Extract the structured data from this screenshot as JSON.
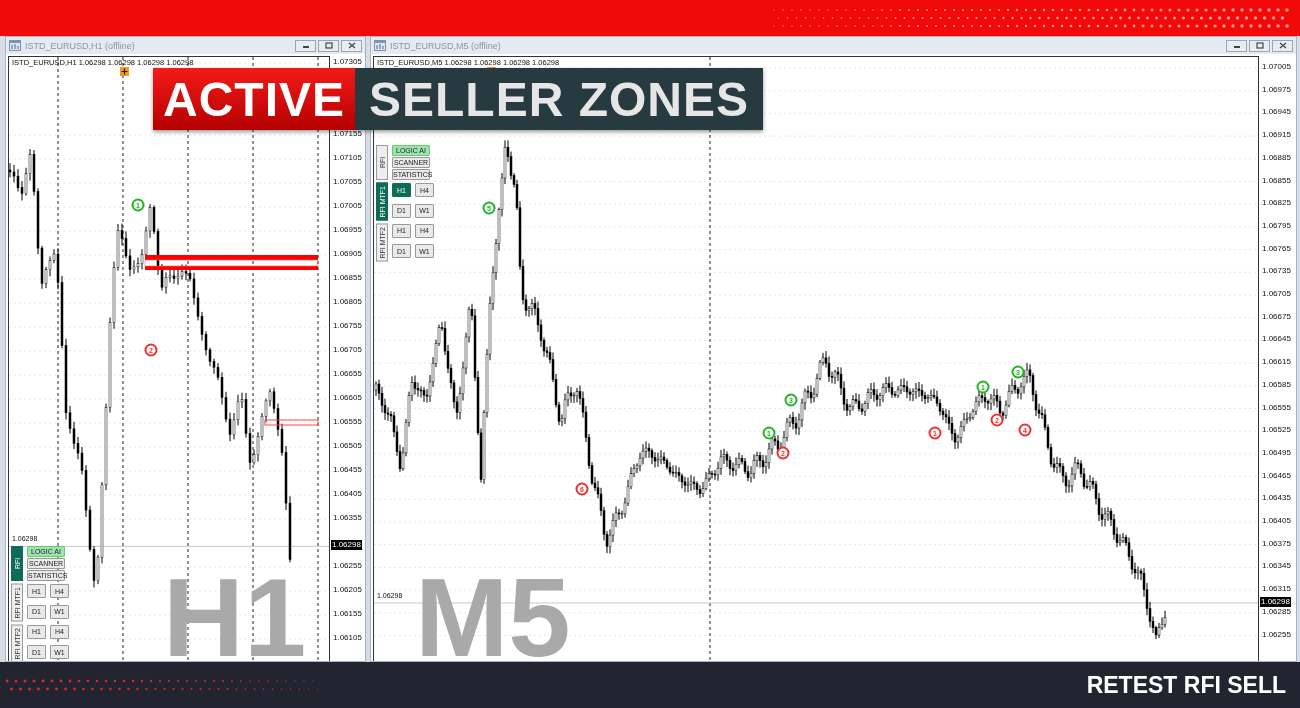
{
  "headline": {
    "highlight": "ACTIVE",
    "text": "SELLER ZONES"
  },
  "windows": [
    {
      "title": "ISTD_EURUSD,H1 (offline)",
      "quote": "ISTD_EURUSD,H1  1.06298 1.06298 1.06298 1.06298",
      "bid_label": "1.06298",
      "price_tag": "1.06298",
      "timeframe_overlay": "H1",
      "axis_labels": [
        "1.07305",
        "1.07155",
        "1.07105",
        "1.07055",
        "1.07005",
        "1.06955",
        "1.06905",
        "1.06855",
        "1.06805",
        "1.06755",
        "1.06705",
        "1.06655",
        "1.06605",
        "1.06555",
        "1.06505",
        "1.06455",
        "1.06405",
        "1.06355",
        "1.06255",
        "1.06205",
        "1.06155",
        "1.06105"
      ],
      "signals": [
        {
          "label": "1",
          "color": "#22b422"
        },
        {
          "label": "2",
          "color": "#ee3030"
        }
      ],
      "panel": [
        {
          "tab": "RFI",
          "selected": true,
          "kind": "list",
          "buttons": [
            {
              "label": "LOGIC AI",
              "selected": true
            },
            {
              "label": "SCANNER",
              "selected": false
            },
            {
              "label": "STATISTICS",
              "selected": false
            }
          ]
        },
        {
          "tab": "RFI MTF1",
          "selected": false,
          "kind": "grid",
          "buttons": [
            {
              "label": "H1",
              "selected": false
            },
            {
              "label": "H4",
              "selected": false
            },
            {
              "label": "D1",
              "selected": false
            },
            {
              "label": "W1",
              "selected": false
            }
          ]
        },
        {
          "tab": "RFI MTF2",
          "selected": false,
          "kind": "grid",
          "buttons": [
            {
              "label": "H1",
              "selected": false
            },
            {
              "label": "H4",
              "selected": false
            },
            {
              "label": "D1",
              "selected": false
            },
            {
              "label": "W1",
              "selected": false
            }
          ]
        }
      ]
    },
    {
      "title": "ISTD_EURUSD,M5 (offline)",
      "quote": "ISTD_EURUSD,M5  1.06298 1.06298 1.06298 1.06298",
      "bid_label": "1.06298",
      "price_tag": "1.06298",
      "timeframe_overlay": "M5",
      "axis_labels": [
        "1.07005",
        "1.06975",
        "1.06945",
        "1.06915",
        "1.06885",
        "1.06855",
        "1.06825",
        "1.06795",
        "1.06765",
        "1.06735",
        "1.06705",
        "1.06675",
        "1.06645",
        "1.06615",
        "1.06585",
        "1.06555",
        "1.06525",
        "1.06495",
        "1.06465",
        "1.06435",
        "1.06405",
        "1.06375",
        "1.06345",
        "1.06315",
        "1.06285",
        "1.06255"
      ],
      "signals": [
        {
          "label": "5",
          "color": "#22b422"
        },
        {
          "label": "6",
          "color": "#ee3030"
        },
        {
          "label": "1",
          "color": "#22b422"
        },
        {
          "label": "3",
          "color": "#22b422"
        },
        {
          "label": "2",
          "color": "#ee3030"
        },
        {
          "label": "1",
          "color": "#ee3030"
        },
        {
          "label": "1",
          "color": "#22b422"
        },
        {
          "label": "2",
          "color": "#ee3030"
        },
        {
          "label": "3",
          "color": "#22b422"
        },
        {
          "label": "4",
          "color": "#ee3030"
        }
      ],
      "panel": [
        {
          "tab": "RFI",
          "selected": false,
          "kind": "list",
          "buttons": [
            {
              "label": "LOGIC AI",
              "selected": true
            },
            {
              "label": "SCANNER",
              "selected": false
            },
            {
              "label": "STATISTICS",
              "selected": false
            }
          ]
        },
        {
          "tab": "RFI MTF1",
          "selected": true,
          "kind": "grid",
          "buttons": [
            {
              "label": "H1",
              "selected": true
            },
            {
              "label": "H4",
              "selected": false
            },
            {
              "label": "D1",
              "selected": false
            },
            {
              "label": "W1",
              "selected": false
            }
          ]
        },
        {
          "tab": "RFI MTF2",
          "selected": false,
          "kind": "grid",
          "buttons": [
            {
              "label": "H1",
              "selected": false
            },
            {
              "label": "H4",
              "selected": false
            },
            {
              "label": "D1",
              "selected": false
            },
            {
              "label": "W1",
              "selected": false
            }
          ]
        }
      ]
    }
  ],
  "footer": {
    "caption": "RETEST RFI SELL"
  }
}
